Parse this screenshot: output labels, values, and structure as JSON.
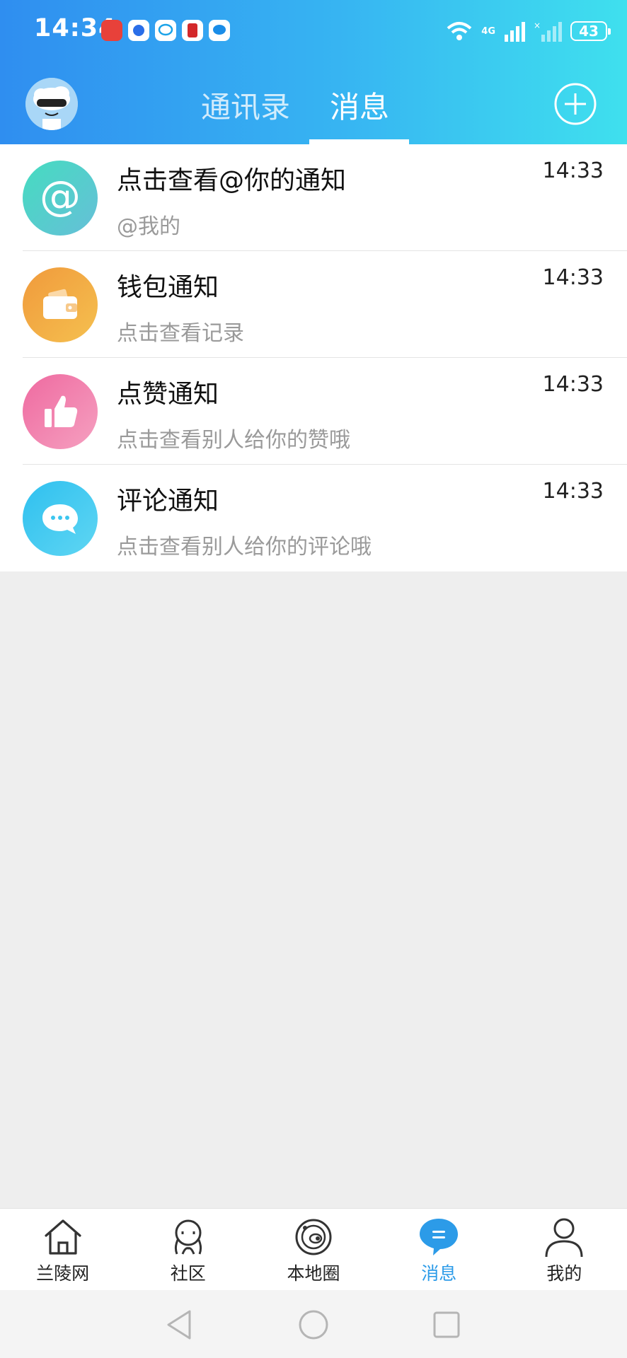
{
  "status_bar": {
    "time": "14:34",
    "network_label": "4G",
    "battery": "43",
    "notification_icons": [
      "app-icon-red",
      "app-icon-blue",
      "chat-bubble-icon",
      "app-icon-red-2",
      "message-app-icon"
    ]
  },
  "top_bar": {
    "tabs": [
      {
        "label": "通讯录",
        "active": false
      },
      {
        "label": "消息",
        "active": true
      }
    ],
    "add_icon": "plus-circle-icon"
  },
  "messages": [
    {
      "title": "点击查看@你的通知",
      "subtitle": "@我的",
      "time": "14:33",
      "icon": "at-icon",
      "color": "#4fd8c0"
    },
    {
      "title": "钱包通知",
      "subtitle": "点击查看记录",
      "time": "14:33",
      "icon": "wallet-icon",
      "color": "#f2a845"
    },
    {
      "title": "点赞通知",
      "subtitle": "点击查看别人给你的赞哦",
      "time": "14:33",
      "icon": "thumbs-up-icon",
      "color": "#f07aa6"
    },
    {
      "title": "评论通知",
      "subtitle": "点击查看别人给你的评论哦",
      "time": "14:33",
      "icon": "comment-icon",
      "color": "#3cc6ef"
    }
  ],
  "bottom_nav": {
    "items": [
      {
        "label": "兰陵网",
        "icon": "home-icon",
        "active": false
      },
      {
        "label": "社区",
        "icon": "community-icon",
        "active": false
      },
      {
        "label": "本地圈",
        "icon": "planet-icon",
        "active": false
      },
      {
        "label": "消息",
        "icon": "message-icon",
        "active": true
      },
      {
        "label": "我的",
        "icon": "person-icon",
        "active": false
      }
    ]
  },
  "colors": {
    "header_start": "#2f8ef0",
    "header_end": "#3fe0ee",
    "active_nav": "#2c9be8",
    "background": "#eeeeee"
  }
}
